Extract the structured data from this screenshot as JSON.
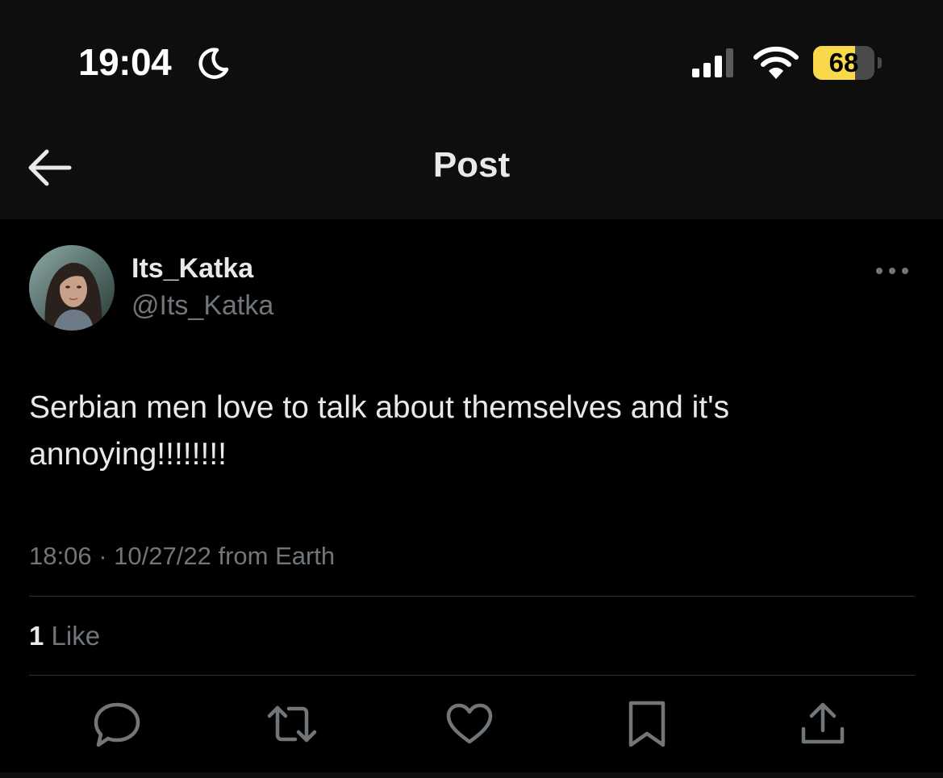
{
  "status_bar": {
    "time": "19:04",
    "battery": "68",
    "battery_level": 0.68,
    "icons": [
      "moon-icon",
      "cellular-signal-icon",
      "wifi-icon",
      "battery-icon"
    ]
  },
  "header": {
    "title": "Post",
    "back_icon": "arrow-left-icon"
  },
  "post": {
    "author": {
      "display_name": "Its_Katka",
      "handle": "@Its_Katka"
    },
    "text": "Serbian men love to talk about themselves and it's annoying!!!!!!!!",
    "time": "18:06",
    "separator": "·",
    "date": "10/27/22",
    "source": "from Earth",
    "likes_count": "1",
    "likes_label": "Like"
  },
  "actions": [
    "reply-icon",
    "repost-icon",
    "like-icon",
    "bookmark-icon",
    "share-icon"
  ],
  "colors": {
    "background": "#000000",
    "header_background": "#0e0e0e",
    "primary_text": "#e7e9ea",
    "secondary_text": "#71767b",
    "divider": "#2f3336",
    "battery": "#f9d84a"
  }
}
